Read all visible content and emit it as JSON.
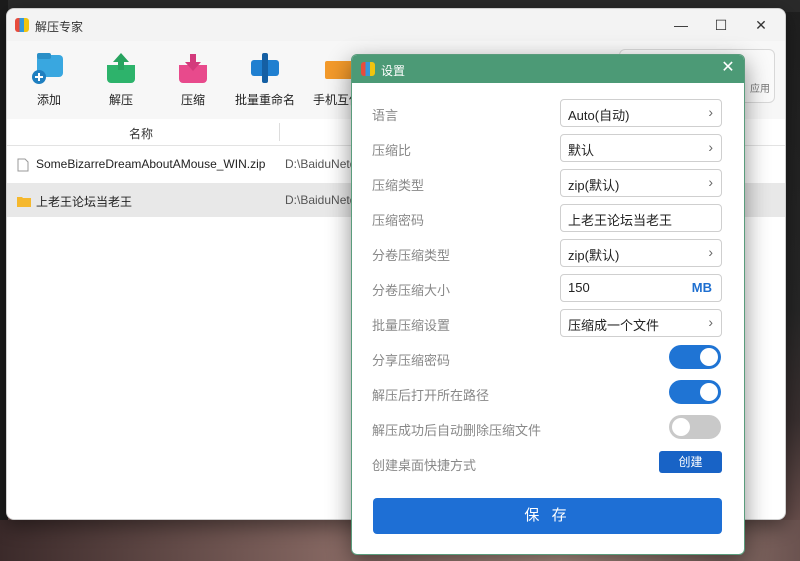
{
  "window": {
    "title": "解压专家",
    "controls": {
      "minimize": "—",
      "maximize": "☐",
      "close": "✕"
    }
  },
  "toolbar": {
    "items": [
      {
        "label": "添加",
        "icon": "add-folder-icon"
      },
      {
        "label": "解压",
        "icon": "extract-icon"
      },
      {
        "label": "压缩",
        "icon": "compress-icon"
      },
      {
        "label": "批量重命名",
        "icon": "batch-rename-icon"
      },
      {
        "label": "手机互传",
        "icon": "phone-transfer-icon"
      }
    ]
  },
  "file_list": {
    "column_name": "名称",
    "rows": [
      {
        "name": "SomeBizarreDreamAboutAMouse_WIN.zip",
        "path": "D:\\BaiduNetd",
        "type": "file"
      },
      {
        "name": "上老王论坛当老王",
        "path": "D:\\BaiduNetd",
        "type": "folder"
      }
    ]
  },
  "right_panel": {
    "text": "应用"
  },
  "settings": {
    "title": "设置",
    "close": "✕",
    "rows": {
      "language": {
        "label": "语言",
        "value": "Auto(自动)"
      },
      "ratio": {
        "label": "压缩比",
        "value": "默认"
      },
      "type": {
        "label": "压缩类型",
        "value": "zip(默认)"
      },
      "password": {
        "label": "压缩密码",
        "value": "上老王论坛当老王"
      },
      "split_type": {
        "label": "分卷压缩类型",
        "value": "zip(默认)"
      },
      "split_size": {
        "label": "分卷压缩大小",
        "value": "150",
        "unit": "MB"
      },
      "batch": {
        "label": "批量压缩设置",
        "value": "压缩成一个文件"
      },
      "share_password": {
        "label": "分享压缩密码",
        "on": true
      },
      "open_path": {
        "label": "解压后打开所在路径",
        "on": true
      },
      "auto_delete": {
        "label": "解压成功后自动删除压缩文件",
        "on": false
      },
      "shortcut": {
        "label": "创建桌面快捷方式",
        "button": "创建"
      }
    },
    "save_label": "保 存"
  },
  "colors": {
    "dialog_title": "#4c9a76",
    "accent": "#1e6fd5"
  }
}
